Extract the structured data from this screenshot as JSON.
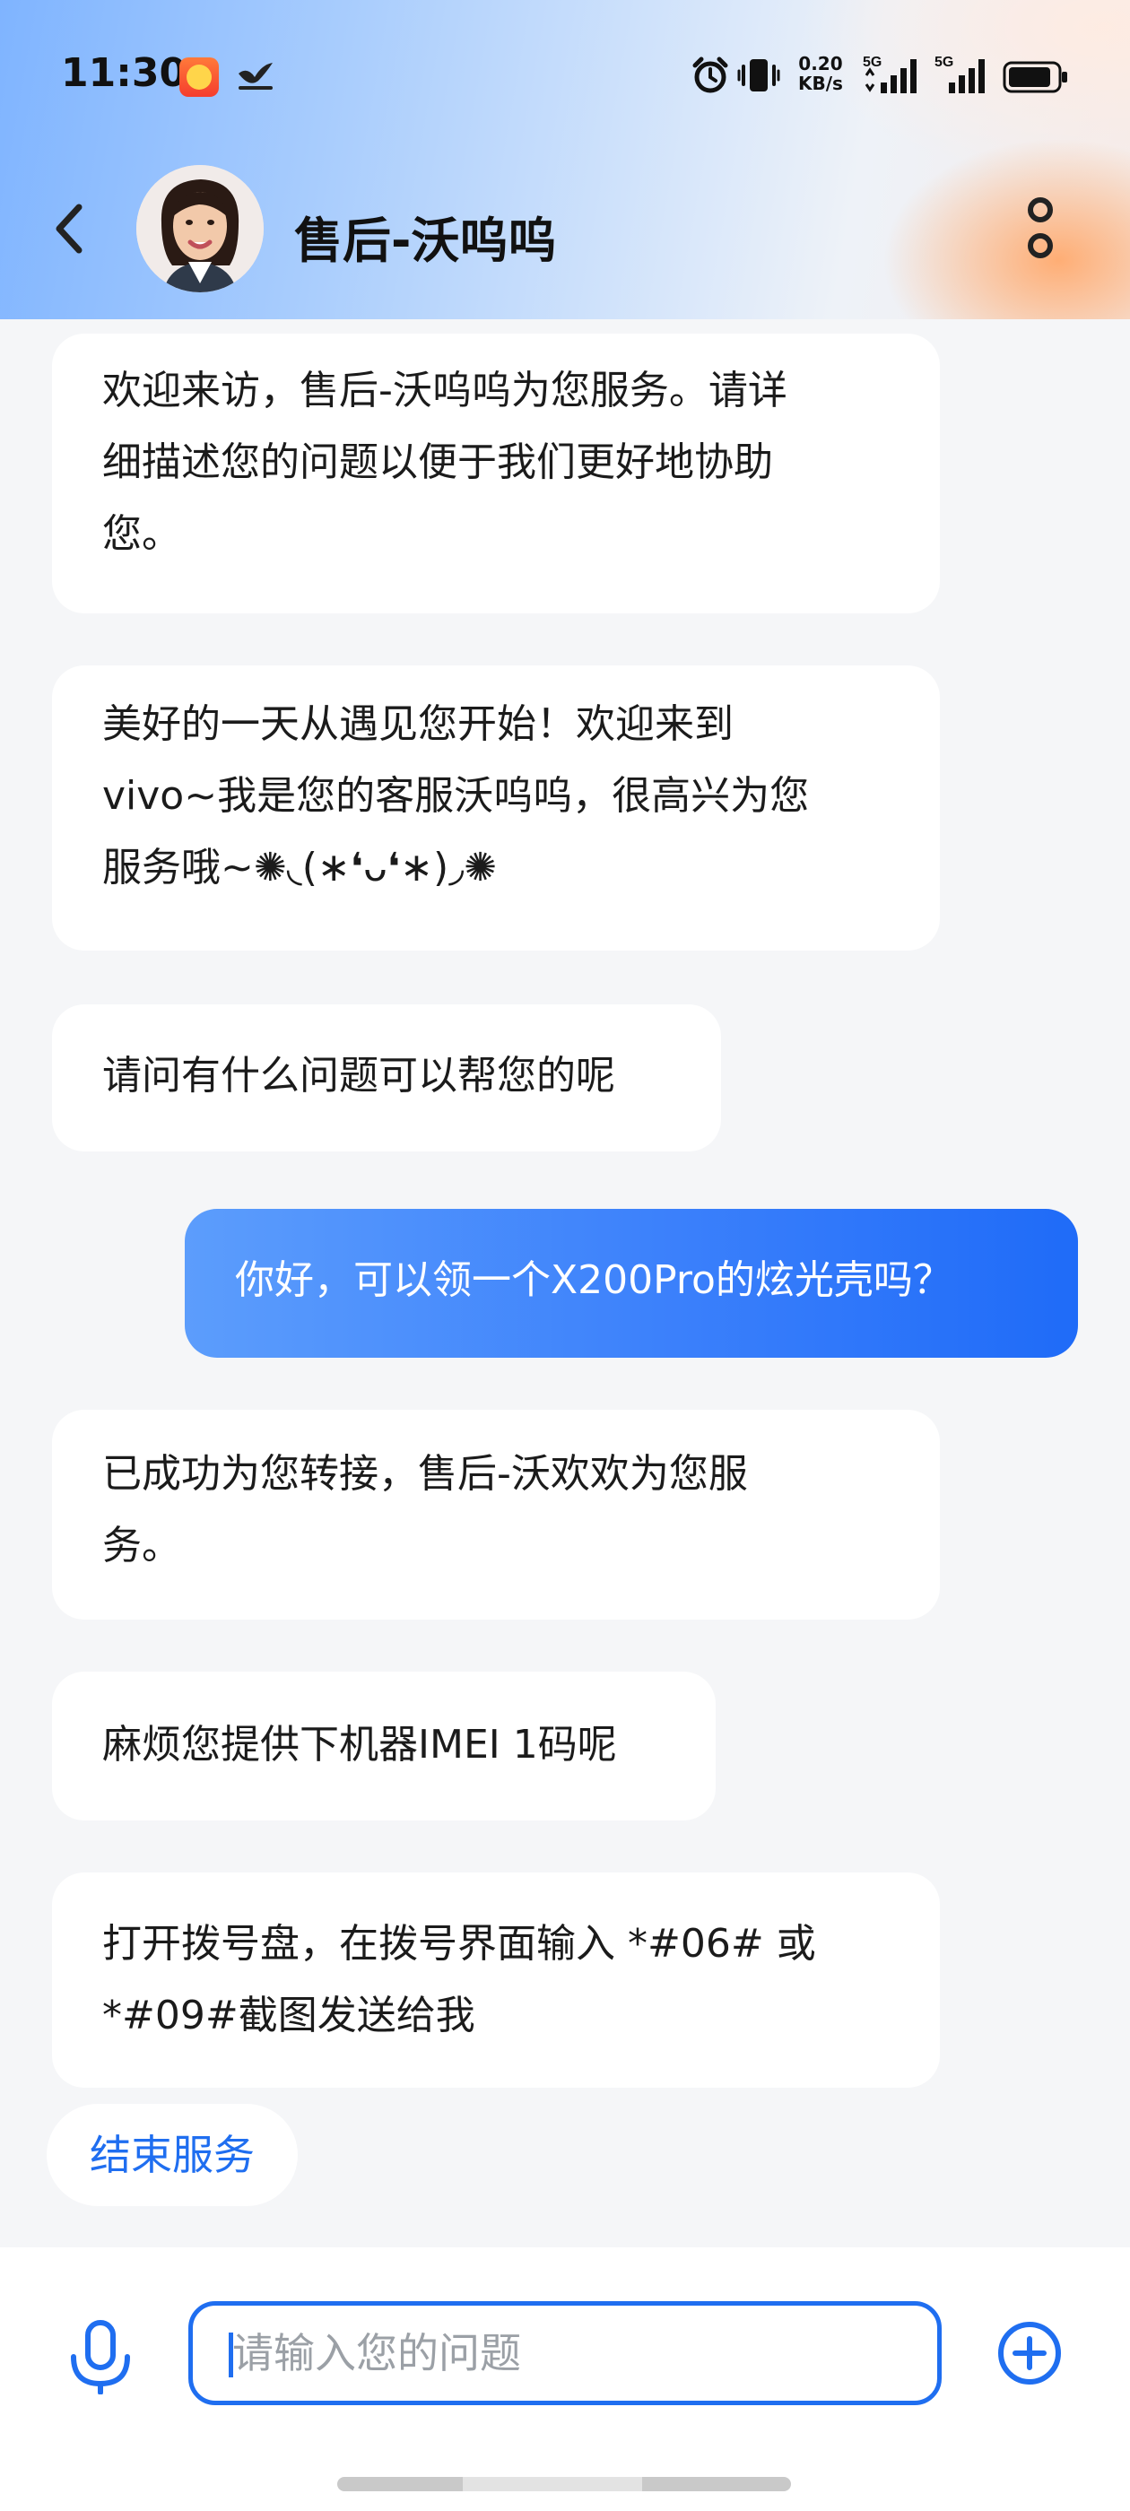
{
  "status_bar": {
    "time": "11:30",
    "net_speed_value": "0.20",
    "net_speed_unit": "KB/s",
    "signal1_label": "5G",
    "signal2_label": "5G",
    "icons": [
      "app-notification-icon",
      "bird-notification-icon",
      "alarm-icon",
      "vibrate-icon",
      "signal-icon",
      "battery-icon"
    ]
  },
  "header": {
    "agent_name": "售后-沃呜呜"
  },
  "messages": [
    {
      "from": "agent",
      "text": "欢迎来访，售后-沃呜呜为您服务。请详\n细描述您的问题以便于我们更好地协助\n您。"
    },
    {
      "from": "agent",
      "text": "美好的一天从遇见您开始！欢迎来到\nvivo~我是您的客服沃呜呜，很高兴为您\n服务哦~✺◟(∗❛ᴗ❛∗)◞✺"
    },
    {
      "from": "agent",
      "text": "请问有什么问题可以帮您的呢"
    },
    {
      "from": "user",
      "text": "你好，可以领一个X200Pro的炫光壳吗？"
    },
    {
      "from": "agent",
      "text": "已成功为您转接，售后-沃欢欢为您服\n务。"
    },
    {
      "from": "agent",
      "text": "麻烦您提供下机器IMEI 1码呢"
    },
    {
      "from": "agent",
      "text": "打开拨号盘，在拨号界面输入 *#06# 或\n*#09#截图发送给我"
    }
  ],
  "end_service_label": "结束服务",
  "input": {
    "placeholder": "请输入您的问题"
  },
  "colors": {
    "accent": "#1f6ef0",
    "user_bubble": "#3b80fb",
    "background": "#f5f6f8"
  }
}
